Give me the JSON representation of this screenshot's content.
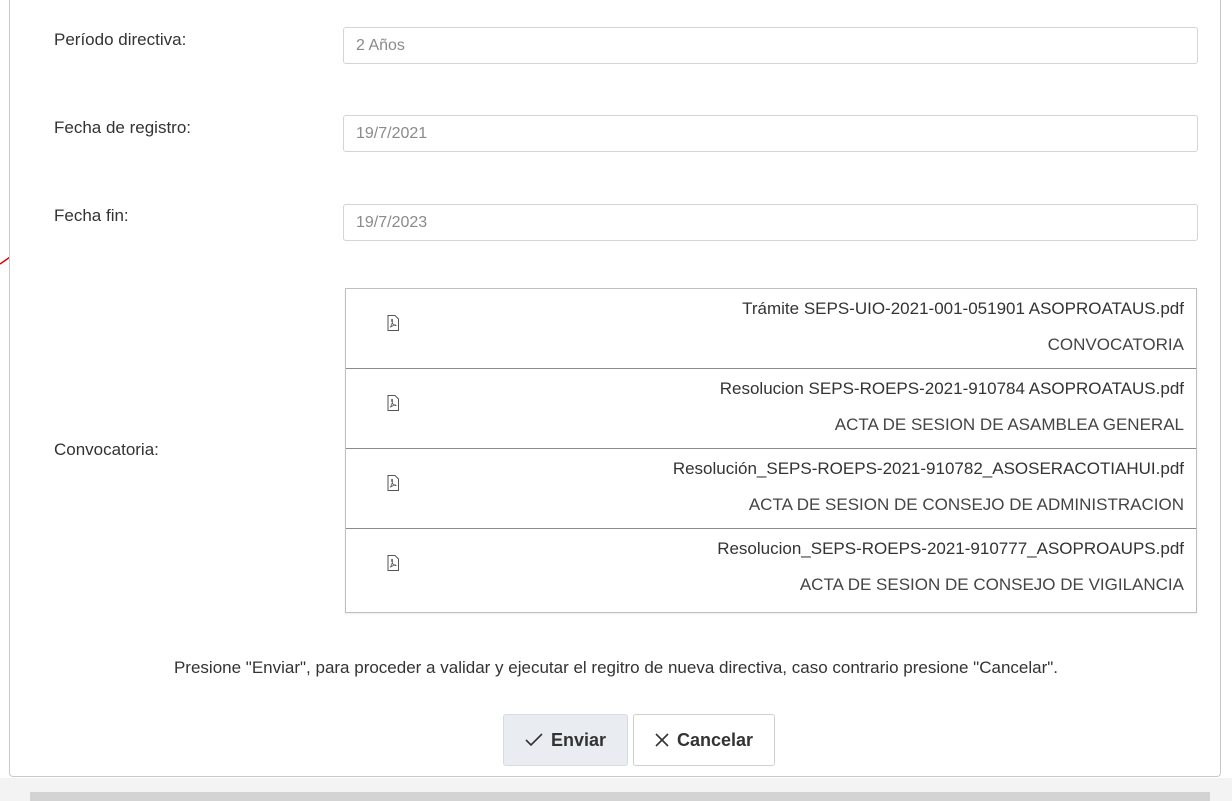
{
  "form": {
    "periodo": {
      "label": "Período directiva:",
      "value": "2 Años"
    },
    "fecha_registro": {
      "label": "Fecha de registro:",
      "value": "19/7/2021"
    },
    "fecha_fin": {
      "label": "Fecha fin:",
      "value": "19/7/2023"
    },
    "convocatoria": {
      "label": "Convocatoria:",
      "files": [
        {
          "name": "Trámite SEPS-UIO-2021-001-051901 ASOPROATAUS.pdf",
          "description": "CONVOCATORIA",
          "icon": "pdf-icon"
        },
        {
          "name": "Resolucion SEPS-ROEPS-2021-910784 ASOPROATAUS.pdf",
          "description": "ACTA DE SESION DE ASAMBLEA GENERAL",
          "icon": "pdf-icon"
        },
        {
          "name": "Resolución_SEPS-ROEPS-2021-910782_ASOSERACOTIAHUI.pdf",
          "description": "ACTA DE SESION DE CONSEJO DE ADMINISTRACION",
          "icon": "pdf-icon"
        },
        {
          "name": "Resolucion_SEPS-ROEPS-2021-910777_ASOPROAUPS.pdf",
          "description": "ACTA DE SESION DE CONSEJO DE VIGILANCIA",
          "icon": "pdf-icon"
        }
      ]
    }
  },
  "message": "Presione \"Enviar\", para proceder a validar y ejecutar el regitro de nueva directiva, caso contrario presione \"Cancelar\".",
  "actions": {
    "send_label": "Enviar",
    "send_icon": "check-icon",
    "cancel_label": "Cancelar",
    "cancel_icon": "close-icon"
  },
  "colors": {
    "annotation_arrow": "#e00000",
    "send_button_bg": "#e9edf2",
    "panel_border": "#c9c9c9"
  }
}
